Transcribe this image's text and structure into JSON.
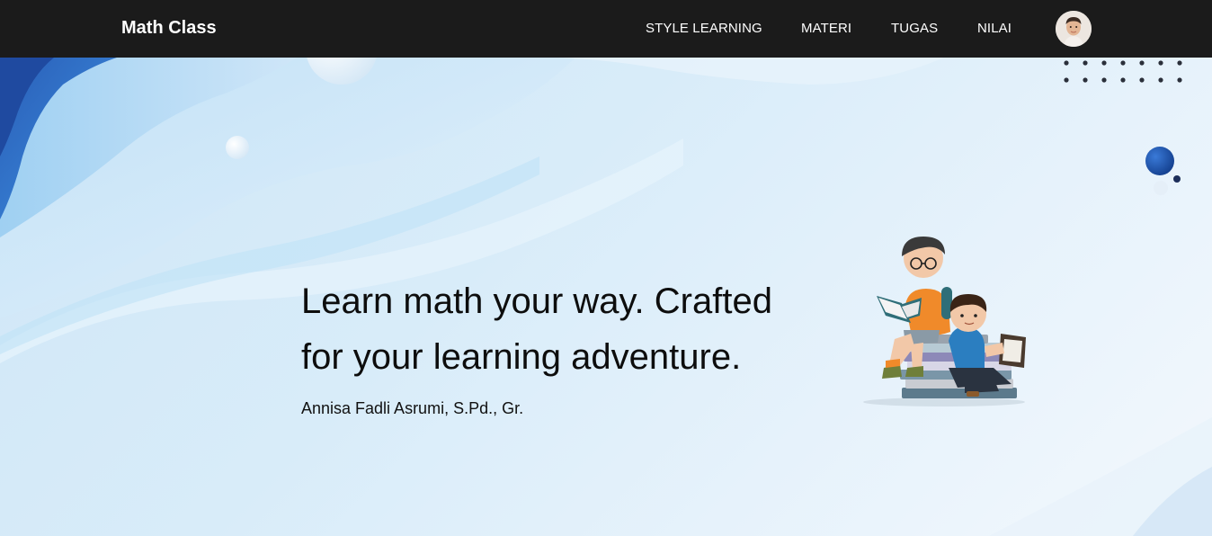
{
  "navbar": {
    "brand": "Math Class",
    "links": [
      {
        "label": "STYLE LEARNING"
      },
      {
        "label": "MATERI"
      },
      {
        "label": "TUGAS"
      },
      {
        "label": "NILAI"
      }
    ],
    "avatar_icon": "user-avatar"
  },
  "hero": {
    "headline_line1": "Learn math your way. Crafted",
    "headline_line2": "for your learning adventure.",
    "author": "Annisa Fadli Asrumi, S.Pd., Gr.",
    "illustration_icon": "kids-reading-books-illustration"
  },
  "colors": {
    "navbar_bg": "#1b1b1b",
    "accent_blue": "#1f6fc9",
    "hero_bg": "#d8ecf9"
  }
}
